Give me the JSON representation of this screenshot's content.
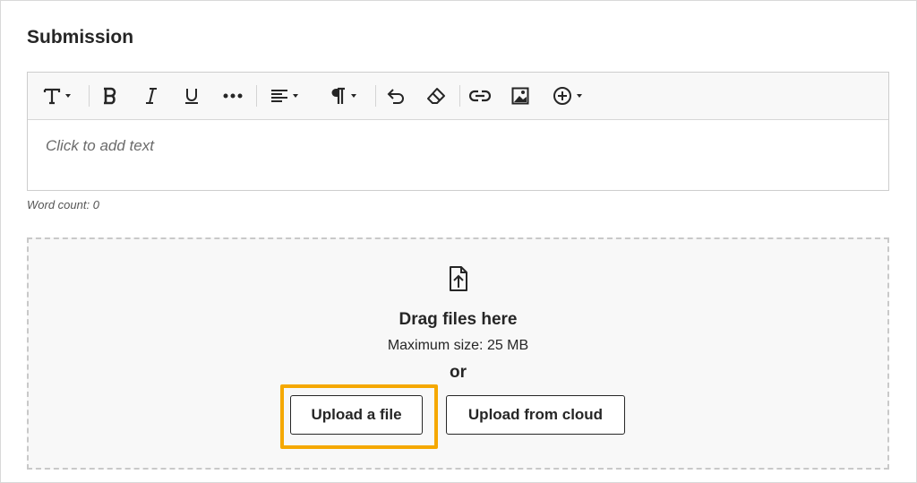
{
  "section": {
    "title": "Submission"
  },
  "editor": {
    "placeholder": "Click to add text",
    "word_count_label": "Word count: 0"
  },
  "toolbar": {
    "items": [
      {
        "icon": "text-style-icon",
        "has_dropdown": true
      },
      {
        "icon": "bold-icon"
      },
      {
        "icon": "italic-icon"
      },
      {
        "icon": "underline-icon"
      },
      {
        "icon": "more-icon"
      },
      {
        "icon": "align-icon",
        "has_dropdown": true
      },
      {
        "icon": "paragraph-icon",
        "has_dropdown": true
      },
      {
        "icon": "undo-icon"
      },
      {
        "icon": "eraser-icon"
      },
      {
        "icon": "link-icon"
      },
      {
        "icon": "image-icon"
      },
      {
        "icon": "add-icon",
        "has_dropdown": true
      }
    ]
  },
  "dropzone": {
    "icon": "file-upload-icon",
    "drag_text": "Drag files here",
    "max_size_text": "Maximum size: 25 MB",
    "or_text": "or",
    "upload_file_label": "Upload a file",
    "upload_cloud_label": "Upload from cloud"
  },
  "colors": {
    "highlight": "#f5a800",
    "toolbar_bg": "#f8f8f8",
    "dropzone_bg": "#f8f8f8",
    "text": "#262626"
  }
}
